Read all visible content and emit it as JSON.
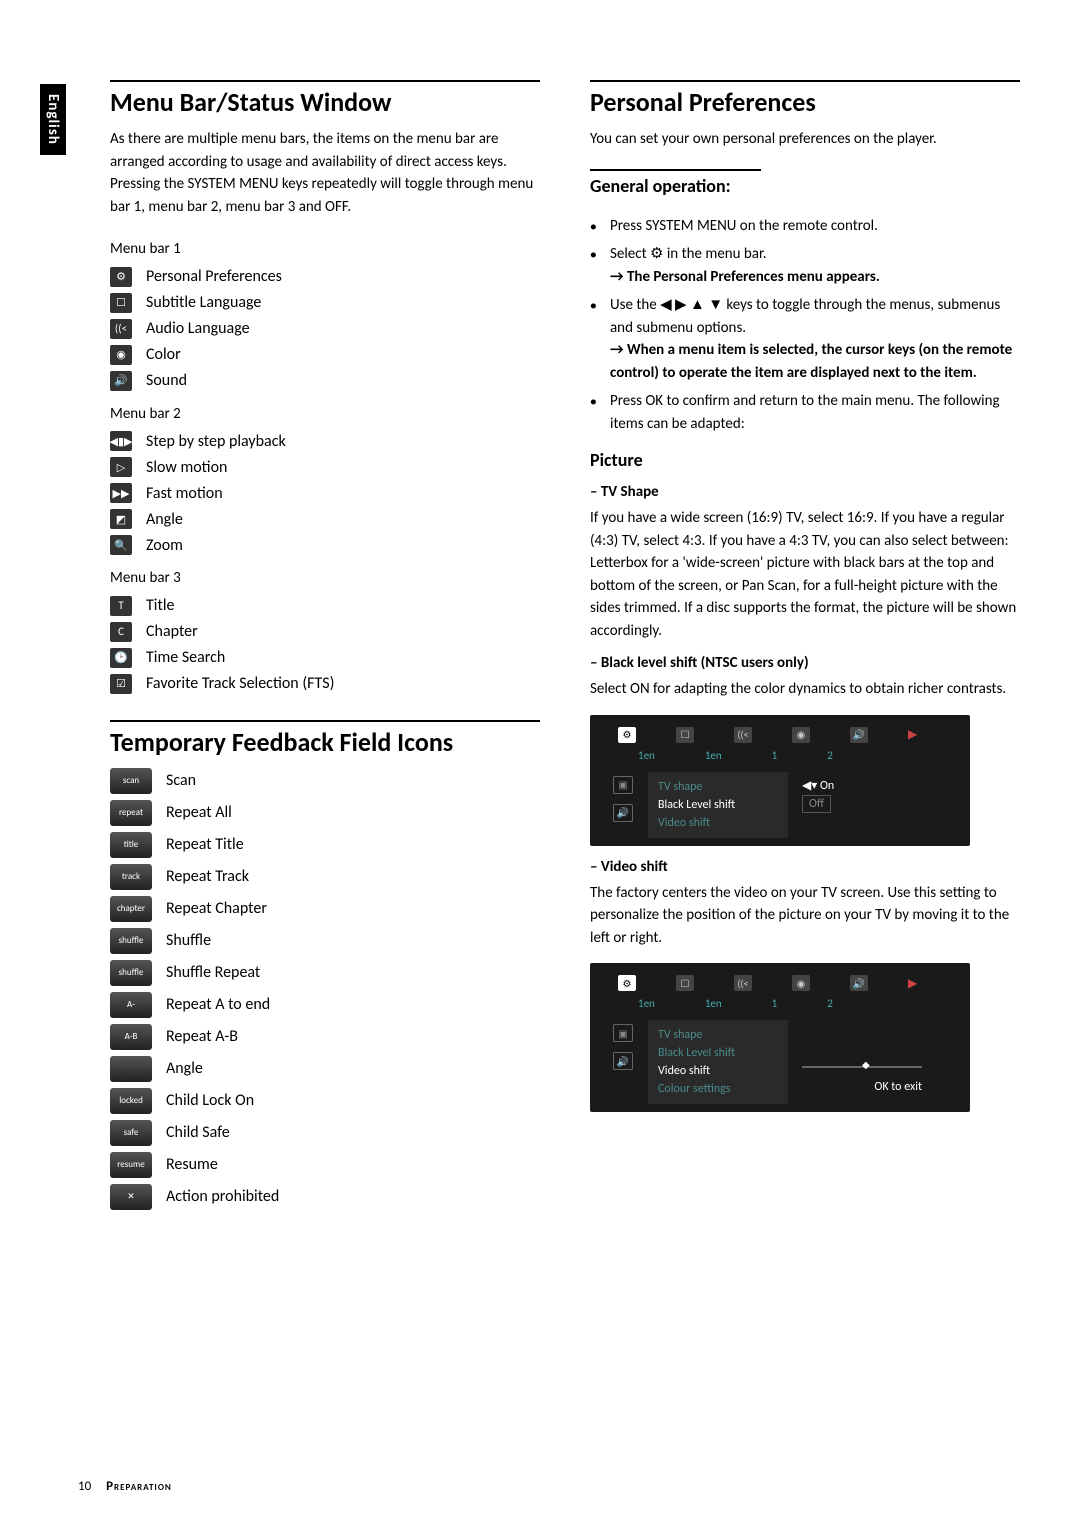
{
  "side_tab": "English",
  "left": {
    "h1": "Menu Bar/Status Window",
    "intro": "As there are multiple menu bars, the items on the menu bar are arranged according to usage and availability of direct access keys. Pressing the SYSTEM MENU keys repeatedly will toggle through menu bar 1, menu bar 2, menu bar 3 and OFF.",
    "bar1_label": "Menu bar 1",
    "bar1": [
      {
        "icon": "⚙",
        "label": "Personal Preferences"
      },
      {
        "icon": "☐",
        "label": "Subtitle Language"
      },
      {
        "icon": "((<",
        "label": "Audio Language"
      },
      {
        "icon": "◉",
        "label": "Color"
      },
      {
        "icon": "🔊",
        "label": "Sound"
      }
    ],
    "bar2_label": "Menu bar 2",
    "bar2": [
      {
        "icon": "◀▮▶",
        "label": "Step by step playback"
      },
      {
        "icon": "▷",
        "label": "Slow motion"
      },
      {
        "icon": "▶▶",
        "label": "Fast motion"
      },
      {
        "icon": "◩",
        "label": "Angle"
      },
      {
        "icon": "🔍",
        "label": "Zoom"
      }
    ],
    "bar3_label": "Menu bar 3",
    "bar3": [
      {
        "icon": "T",
        "label": "Title"
      },
      {
        "icon": "C",
        "label": "Chapter"
      },
      {
        "icon": "🕑",
        "label": "Time Search"
      },
      {
        "icon": "☑",
        "label": "Favorite Track Selection (FTS)"
      }
    ],
    "h1b": "Temporary Feedback Field Icons",
    "feedback": [
      {
        "icon": "scan",
        "label": "Scan"
      },
      {
        "icon": "repeat",
        "label": "Repeat All"
      },
      {
        "icon": "title",
        "label": "Repeat Title"
      },
      {
        "icon": "track",
        "label": "Repeat Track"
      },
      {
        "icon": "chapter",
        "label": "Repeat Chapter"
      },
      {
        "icon": "shuffle",
        "label": "Shuffle"
      },
      {
        "icon": "shuffle",
        "label": "Shuffle Repeat"
      },
      {
        "icon": "A-",
        "label": "Repeat A to end"
      },
      {
        "icon": "A-B",
        "label": "Repeat A-B"
      },
      {
        "icon": "",
        "label": "Angle"
      },
      {
        "icon": "locked",
        "label": "Child Lock On"
      },
      {
        "icon": "safe",
        "label": "Child Safe"
      },
      {
        "icon": "resume",
        "label": "Resume"
      },
      {
        "icon": "✕",
        "label": "Action prohibited"
      }
    ]
  },
  "right": {
    "h1": "Personal Preferences",
    "intro": "You can set your own personal preferences on the player.",
    "genop_h": "General operation:",
    "genop": [
      "Press SYSTEM MENU on the remote control.",
      "Select ⚙ in the menu bar.",
      "Use the ◀ ▶ ▲ ▼ keys to toggle through the menus, submenus and submenu options.",
      "Press OK to confirm and return to the main menu. The following items can be adapted:"
    ],
    "genop_sub1": "→ The Personal Preferences menu appears.",
    "genop_sub2": "→ When a menu item is selected, the cursor keys (on the remote control) to operate the item are displayed next to the item.",
    "picture_h": "Picture",
    "tvshape_h": "–  TV Shape",
    "tvshape_p": "If you have a wide screen (16:9) TV, select 16:9. If you have a regular (4:3) TV, select 4:3. If you have a 4:3 TV, you can also select between: Letterbox for a 'wide-screen' picture with black bars at the top and bottom of the screen, or Pan Scan, for a full-height picture with the sides trimmed. If a disc supports the format, the picture will be shown accordingly.",
    "black_h": "–  Black level shift (NTSC users only)",
    "black_p": "Select ON for adapting the color dynamics to obtain richer contrasts.",
    "ss1": {
      "tabs_sub": [
        "1en",
        "1en",
        "1",
        "2"
      ],
      "menu": [
        "TV shape",
        "Black Level shift",
        "Video shift"
      ],
      "sel": "Black Level shift",
      "right": [
        "On",
        "Off"
      ]
    },
    "video_h": "–  Video shift",
    "video_p": "The factory centers the video on your TV screen. Use this setting to personalize the position of the picture on your TV by moving it to the left or right.",
    "ss2": {
      "tabs_sub": [
        "1en",
        "1en",
        "1",
        "2"
      ],
      "menu": [
        "TV shape",
        "Black Level shift",
        "Video shift",
        "Colour settings"
      ],
      "sel": "Video shift",
      "right_note": "OK to exit"
    }
  },
  "footer": {
    "page": "10",
    "section": "Preparation"
  }
}
